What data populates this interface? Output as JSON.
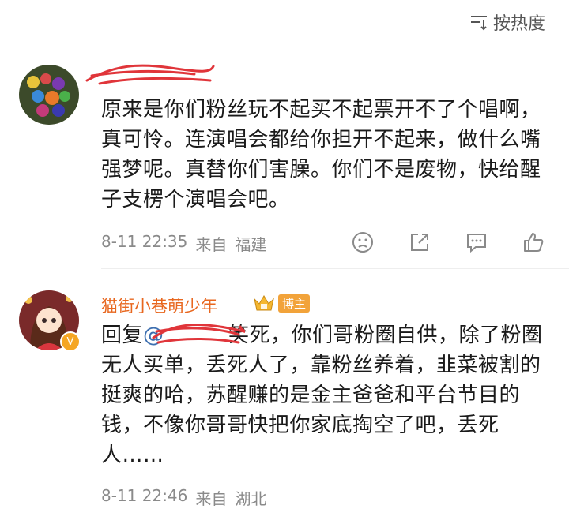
{
  "sort": {
    "label": "按热度",
    "icon": "sort-icon"
  },
  "comments": [
    {
      "username": "",
      "text": "原来是你们粉丝玩不起买不起票开不了个唱啊，真可怜。连演唱会都给你担开不起来，做什么嘴强梦呢。真替你们害臊。你们不是废物，快给醒子支楞个演唱会吧。",
      "time": "8-11 22:35",
      "from_label": "来自",
      "location": "福建",
      "actions": [
        "dislike-icon",
        "share-icon",
        "comment-icon",
        "like-icon"
      ]
    },
    {
      "username": "猫街小巷萌少年",
      "badge": "博主",
      "reply_prefix": "回复",
      "mention": "@",
      "text": "笑死，你们哥粉圈自供，除了粉圈无人买单，丢死人了，靠粉丝养着，韭菜被割的挺爽的哈，苏醒赚的是金主爸爸和平台节目的钱，不像你哥哥快把你家底掏空了吧，丢死人……",
      "time": "8-11 22:46",
      "from_label": "来自",
      "location": "湖北",
      "actions": [
        "dislike-icon",
        "share-icon",
        "comment-icon",
        "like-icon"
      ]
    }
  ],
  "colors": {
    "username_highlight": "#e8671f",
    "mention": "#3d6fb0",
    "meta": "#8a8a8a",
    "scribble": "#e0353a"
  }
}
